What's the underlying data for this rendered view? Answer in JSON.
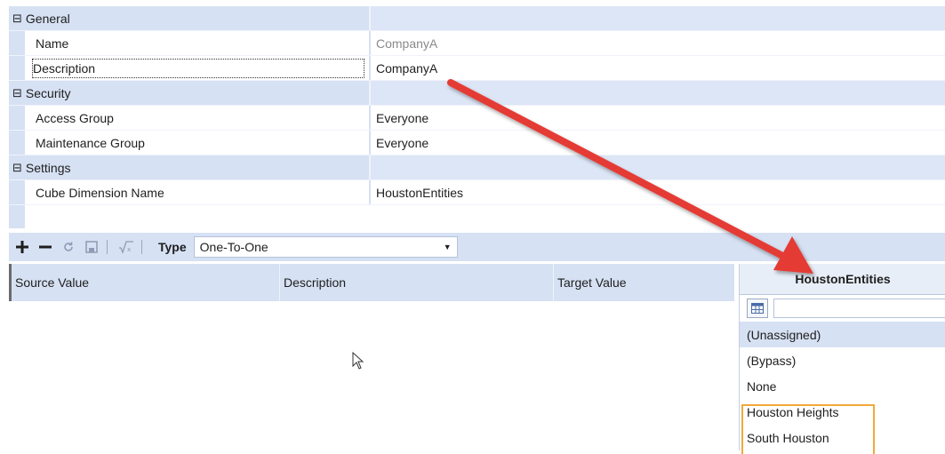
{
  "properties": {
    "categories": [
      {
        "title": "General",
        "toggle": "⊟",
        "rows": [
          {
            "label": "Name",
            "value": "CompanyA"
          },
          {
            "label": "Description",
            "value": "CompanyA"
          }
        ]
      },
      {
        "title": "Security",
        "toggle": "⊟",
        "rows": [
          {
            "label": "Access Group",
            "value": "Everyone"
          },
          {
            "label": "Maintenance Group",
            "value": "Everyone"
          }
        ]
      },
      {
        "title": "Settings",
        "toggle": "⊟",
        "rows": [
          {
            "label": "Cube Dimension Name",
            "value": "HoustonEntities"
          }
        ]
      }
    ]
  },
  "toolbar": {
    "type_label": "Type",
    "type_value": "One-To-One",
    "icons": [
      "plus-icon",
      "minus-icon",
      "refresh-icon",
      "save-icon",
      "formula-icon"
    ]
  },
  "source_grid": {
    "columns": [
      "Source Value",
      "Description",
      "Target Value"
    ]
  },
  "target_panel": {
    "header": "HoustonEntities",
    "items": [
      "(Unassigned)",
      "(Bypass)",
      "None",
      "Houston Heights",
      "South Houston"
    ],
    "selected_index": 0
  },
  "colors": {
    "accent_blue": "#d6e1f3",
    "arrow_red": "#e53a35",
    "highlight_orange": "#f0a93a"
  }
}
